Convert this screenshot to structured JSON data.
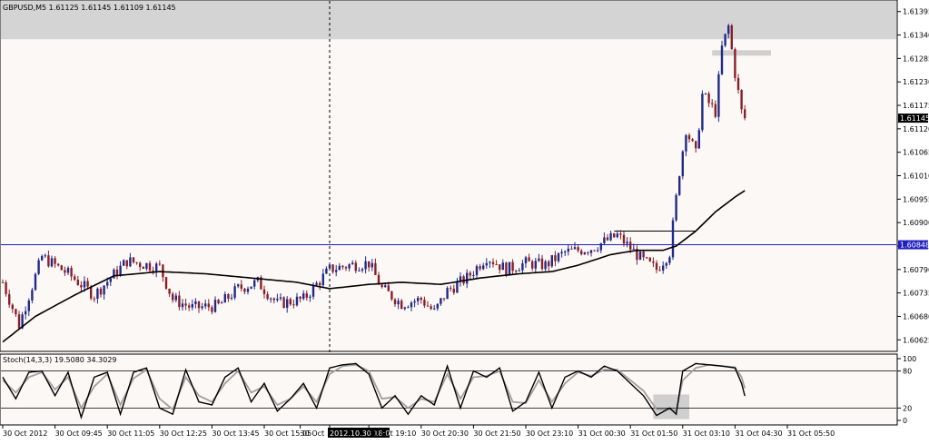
{
  "window": {
    "symbol_header": "GBPUSD,M5  1.61125 1.61145 1.61109 1.61145"
  },
  "colors": {
    "background": "#ffffff",
    "plot_background": "#fcf8f6",
    "bull_candle": "#1f2a8a",
    "bear_candle": "#8a1f2a",
    "moving_average": "#000000",
    "horizontal_line": "#2020c0",
    "stoch_main": "#000000",
    "stoch_signal": "#a0a0a0",
    "shade_box": "#cfcfcf"
  },
  "chart_data": [
    {
      "type": "candlestick",
      "title": "GBPUSD,M5",
      "ohlc_header": {
        "open": 1.61125,
        "high": 1.61145,
        "low": 1.61109,
        "close": 1.61145
      },
      "ylim": [
        1.606,
        1.6142
      ],
      "y_ticks": [
        "1.61395",
        "1.61340",
        "1.61285",
        "1.61230",
        "1.61175",
        "1.61120",
        "1.61065",
        "1.61010",
        "1.60955",
        "1.60900",
        "1.60845",
        "1.60790",
        "1.60735",
        "1.60680",
        "1.60625"
      ],
      "current_price_label": "1.61145",
      "hline": {
        "price": 1.60848,
        "label": "1.60848"
      },
      "top_band": {
        "from": 1.6133,
        "to": 1.6142
      },
      "resistance_marks": [
        {
          "price": 1.61298,
          "bar_from": 217,
          "bar_to": 235
        },
        {
          "price": 1.6088,
          "bar_from": 187,
          "bar_to": 212
        }
      ],
      "vertical_marker_bar": 100,
      "x_tick_labels": [
        "30 Oct 2012",
        "30 Oct 09:45",
        "30 Oct 11:05",
        "30 Oct 12:25",
        "30 Oct 13:45",
        "30 Oct 15:05",
        "30 Oct",
        "2012.10.30 18:00",
        "30 Oct 19:10",
        "30 Oct 20:30",
        "30 Oct 21:50",
        "30 Oct 23:10",
        "31 Oct 00:30",
        "31 Oct 01:50",
        "31 Oct 03:10",
        "31 Oct 04:30",
        "31 Oct 05:50"
      ],
      "x_tick_bars": [
        0,
        16,
        32,
        48,
        64,
        80,
        91,
        100,
        112,
        128,
        144,
        160,
        176,
        192,
        208,
        224,
        240
      ],
      "highlighted_tick_index": 7,
      "candle_count": 228,
      "price_path": [
        [
          0,
          1.6076
        ],
        [
          5,
          1.6066
        ],
        [
          12,
          1.6082
        ],
        [
          20,
          1.6078
        ],
        [
          28,
          1.6073
        ],
        [
          38,
          1.6081
        ],
        [
          48,
          1.60795
        ],
        [
          52,
          1.6072
        ],
        [
          58,
          1.607
        ],
        [
          66,
          1.60705
        ],
        [
          72,
          1.60745
        ],
        [
          78,
          1.6076
        ],
        [
          84,
          1.6071
        ],
        [
          92,
          1.6072
        ],
        [
          100,
          1.6079
        ],
        [
          106,
          1.608
        ],
        [
          112,
          1.60805
        ],
        [
          116,
          1.60745
        ],
        [
          122,
          1.6071
        ],
        [
          128,
          1.6072
        ],
        [
          132,
          1.6069
        ],
        [
          136,
          1.6074
        ],
        [
          142,
          1.6077
        ],
        [
          148,
          1.6082
        ],
        [
          154,
          1.6079
        ],
        [
          160,
          1.60805
        ],
        [
          166,
          1.608
        ],
        [
          172,
          1.6083
        ],
        [
          180,
          1.6084
        ],
        [
          188,
          1.6087
        ],
        [
          196,
          1.6081
        ],
        [
          200,
          1.6079
        ],
        [
          204,
          1.6083
        ],
        [
          207,
          1.6102
        ],
        [
          209,
          1.6112
        ],
        [
          212,
          1.6106
        ],
        [
          214,
          1.612
        ],
        [
          218,
          1.6116
        ],
        [
          220,
          1.6131
        ],
        [
          222,
          1.6136
        ],
        [
          224,
          1.6125
        ],
        [
          226,
          1.6116
        ],
        [
          228,
          1.61145
        ]
      ],
      "moving_average_path": [
        [
          0,
          1.6062
        ],
        [
          10,
          1.6068
        ],
        [
          22,
          1.6073
        ],
        [
          34,
          1.60775
        ],
        [
          48,
          1.60785
        ],
        [
          62,
          1.6078
        ],
        [
          76,
          1.6077
        ],
        [
          90,
          1.6076
        ],
        [
          100,
          1.60745
        ],
        [
          112,
          1.60755
        ],
        [
          122,
          1.6076
        ],
        [
          134,
          1.60755
        ],
        [
          146,
          1.6077
        ],
        [
          158,
          1.6078
        ],
        [
          168,
          1.60785
        ],
        [
          176,
          1.608
        ],
        [
          186,
          1.60825
        ],
        [
          194,
          1.60835
        ],
        [
          202,
          1.60835
        ],
        [
          206,
          1.60845
        ],
        [
          212,
          1.6088
        ],
        [
          218,
          1.60925
        ],
        [
          224,
          1.6096
        ],
        [
          228,
          1.6098
        ]
      ]
    },
    {
      "type": "line",
      "title": "Stoch(14,3,3) 19.5080 34.3029",
      "ylim": [
        0,
        100
      ],
      "y_ticks": [
        "100",
        "80",
        "20",
        "0"
      ],
      "levels": [
        80,
        20
      ],
      "shade_box": {
        "bar_from": 199,
        "bar_to": 210,
        "y_from": 2,
        "y_to": 42
      },
      "main_path": [
        [
          0,
          70
        ],
        [
          4,
          35
        ],
        [
          8,
          78
        ],
        [
          12,
          80
        ],
        [
          16,
          40
        ],
        [
          20,
          78
        ],
        [
          24,
          5
        ],
        [
          28,
          70
        ],
        [
          32,
          78
        ],
        [
          36,
          10
        ],
        [
          40,
          78
        ],
        [
          44,
          85
        ],
        [
          48,
          20
        ],
        [
          52,
          10
        ],
        [
          56,
          82
        ],
        [
          60,
          30
        ],
        [
          64,
          25
        ],
        [
          68,
          70
        ],
        [
          72,
          85
        ],
        [
          76,
          30
        ],
        [
          80,
          60
        ],
        [
          84,
          15
        ],
        [
          88,
          35
        ],
        [
          92,
          60
        ],
        [
          96,
          20
        ],
        [
          100,
          85
        ],
        [
          104,
          90
        ],
        [
          108,
          92
        ],
        [
          112,
          75
        ],
        [
          116,
          20
        ],
        [
          120,
          40
        ],
        [
          124,
          10
        ],
        [
          128,
          40
        ],
        [
          132,
          25
        ],
        [
          136,
          88
        ],
        [
          140,
          20
        ],
        [
          144,
          80
        ],
        [
          148,
          70
        ],
        [
          152,
          85
        ],
        [
          156,
          15
        ],
        [
          160,
          30
        ],
        [
          164,
          78
        ],
        [
          168,
          20
        ],
        [
          172,
          70
        ],
        [
          176,
          80
        ],
        [
          180,
          70
        ],
        [
          184,
          88
        ],
        [
          188,
          80
        ],
        [
          192,
          60
        ],
        [
          196,
          40
        ],
        [
          200,
          8
        ],
        [
          204,
          20
        ],
        [
          206,
          10
        ],
        [
          208,
          80
        ],
        [
          212,
          92
        ],
        [
          216,
          90
        ],
        [
          220,
          88
        ],
        [
          224,
          85
        ],
        [
          226,
          60
        ],
        [
          228,
          19
        ]
      ],
      "signal_path": [
        [
          0,
          65
        ],
        [
          4,
          45
        ],
        [
          8,
          70
        ],
        [
          12,
          78
        ],
        [
          16,
          50
        ],
        [
          20,
          70
        ],
        [
          24,
          20
        ],
        [
          28,
          55
        ],
        [
          32,
          75
        ],
        [
          36,
          25
        ],
        [
          40,
          68
        ],
        [
          44,
          82
        ],
        [
          48,
          35
        ],
        [
          52,
          18
        ],
        [
          56,
          70
        ],
        [
          60,
          40
        ],
        [
          64,
          30
        ],
        [
          68,
          60
        ],
        [
          72,
          80
        ],
        [
          76,
          45
        ],
        [
          80,
          55
        ],
        [
          84,
          25
        ],
        [
          88,
          35
        ],
        [
          92,
          55
        ],
        [
          96,
          30
        ],
        [
          100,
          75
        ],
        [
          104,
          88
        ],
        [
          108,
          90
        ],
        [
          112,
          80
        ],
        [
          116,
          35
        ],
        [
          120,
          38
        ],
        [
          124,
          20
        ],
        [
          128,
          35
        ],
        [
          132,
          30
        ],
        [
          136,
          75
        ],
        [
          140,
          35
        ],
        [
          144,
          70
        ],
        [
          148,
          72
        ],
        [
          152,
          80
        ],
        [
          156,
          30
        ],
        [
          160,
          28
        ],
        [
          164,
          65
        ],
        [
          168,
          30
        ],
        [
          172,
          60
        ],
        [
          176,
          78
        ],
        [
          180,
          72
        ],
        [
          184,
          82
        ],
        [
          188,
          82
        ],
        [
          192,
          65
        ],
        [
          196,
          48
        ],
        [
          200,
          18
        ],
        [
          204,
          18
        ],
        [
          206,
          15
        ],
        [
          208,
          65
        ],
        [
          212,
          85
        ],
        [
          216,
          90
        ],
        [
          220,
          88
        ],
        [
          224,
          86
        ],
        [
          226,
          70
        ],
        [
          228,
          34
        ]
      ]
    }
  ]
}
